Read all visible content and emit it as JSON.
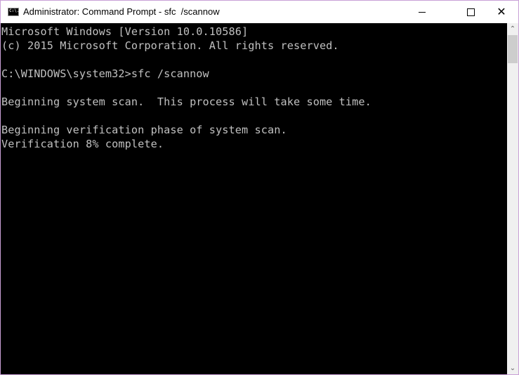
{
  "window": {
    "title": "Administrator: Command Prompt - sfc  /scannow",
    "icon": "cmd-icon",
    "icon_text": "C:\\."
  },
  "controls": {
    "minimize": "minimize-icon",
    "maximize": "maximize-icon",
    "close_glyph": "✕"
  },
  "console": {
    "lines": [
      "Microsoft Windows [Version 10.0.10586]",
      "(c) 2015 Microsoft Corporation. All rights reserved.",
      "",
      "C:\\WINDOWS\\system32>sfc /scannow",
      "",
      "Beginning system scan.  This process will take some time.",
      "",
      "Beginning verification phase of system scan.",
      "Verification 8% complete."
    ],
    "text_color": "#c0c0c0",
    "background": "#000000"
  },
  "scrollbar": {
    "up_glyph": "⌃",
    "down_glyph": "⌄"
  }
}
